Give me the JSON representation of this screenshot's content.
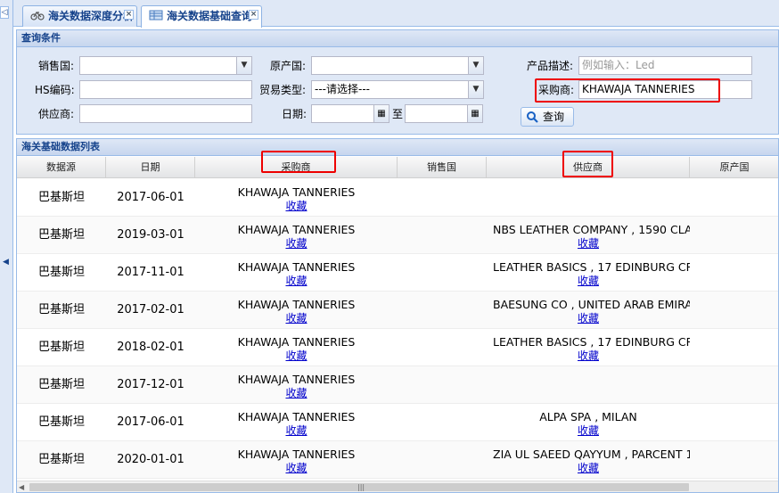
{
  "tabs": [
    {
      "label": "海关数据深度分析",
      "active": false
    },
    {
      "label": "海关数据基础查询",
      "active": true
    }
  ],
  "query": {
    "title": "查询条件",
    "sales_country_label": "销售国:",
    "origin_country_label": "原产国:",
    "product_desc_label": "产品描述:",
    "product_desc_placeholder": "例如输入：Led",
    "hs_code_label": "HS编码:",
    "trade_type_label": "贸易类型:",
    "trade_type_value": "---请选择---",
    "buyer_label": "采购商:",
    "buyer_value": "KHAWAJA TANNERIES",
    "supplier_label": "供应商:",
    "date_label": "日期:",
    "date_to": "至",
    "query_button": "查询"
  },
  "grid": {
    "title": "海关基础数据列表",
    "columns": [
      "数据源",
      "日期",
      "采购商",
      "销售国",
      "供应商",
      "原产国"
    ],
    "fav_label": "收藏",
    "rows": [
      {
        "source": "巴基斯坦",
        "date": "2017-06-01",
        "buyer": "KHAWAJA TANNERIES",
        "supplier": ""
      },
      {
        "source": "巴基斯坦",
        "date": "2019-03-01",
        "buyer": "KHAWAJA TANNERIES",
        "supplier": "NBS LEATHER COMPANY , 1590 CLA"
      },
      {
        "source": "巴基斯坦",
        "date": "2017-11-01",
        "buyer": "KHAWAJA TANNERIES",
        "supplier": "LEATHER BASICS , 17 EDINBURG CR"
      },
      {
        "source": "巴基斯坦",
        "date": "2017-02-01",
        "buyer": "KHAWAJA TANNERIES",
        "supplier": "BAESUNG CO , UNITED ARAB EMIRA"
      },
      {
        "source": "巴基斯坦",
        "date": "2018-02-01",
        "buyer": "KHAWAJA TANNERIES",
        "supplier": "LEATHER BASICS , 17 EDINBURG CR"
      },
      {
        "source": "巴基斯坦",
        "date": "2017-12-01",
        "buyer": "KHAWAJA TANNERIES",
        "supplier": ""
      },
      {
        "source": "巴基斯坦",
        "date": "2017-06-01",
        "buyer": "KHAWAJA TANNERIES",
        "supplier": "ALPA SPA , MILAN"
      },
      {
        "source": "巴基斯坦",
        "date": "2020-01-01",
        "buyer": "KHAWAJA TANNERIES",
        "supplier": "ZIA UL SAEED QAYYUM , PARCENT 1"
      }
    ]
  },
  "colors": {
    "highlight": "#e00000",
    "link": "#0000cc",
    "header_text": "#15428b"
  }
}
